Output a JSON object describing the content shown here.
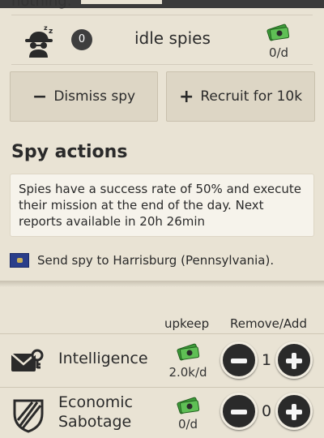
{
  "top": {
    "clipped_text": "nothing."
  },
  "idle": {
    "count": "0",
    "label": "idle spies",
    "rate": "0/d"
  },
  "buttons": {
    "dismiss": "Dismiss spy",
    "recruit": "Recruit for 10k"
  },
  "spy_actions": {
    "title": "Spy actions",
    "info": "Spies have a success rate of 50% and execute their mission at the end of the day. Next reports available in 20h 26min",
    "send": "Send spy to Harrisburg (Pennsylvania)."
  },
  "table": {
    "upkeep_header": "upkeep",
    "remove_add_header": "Remove/Add",
    "rows": [
      {
        "label": "Intelligence",
        "upkeep": "2.0k/d",
        "qty": "1"
      },
      {
        "label_line1": "Economic",
        "label_line2": "Sabotage",
        "upkeep": "0/d",
        "qty": "0"
      }
    ]
  },
  "colors": {
    "background": "#e9e3d4",
    "button": "#ddd6c5",
    "dark": "#2a2a2a",
    "money_green": "#3f9b3a"
  }
}
